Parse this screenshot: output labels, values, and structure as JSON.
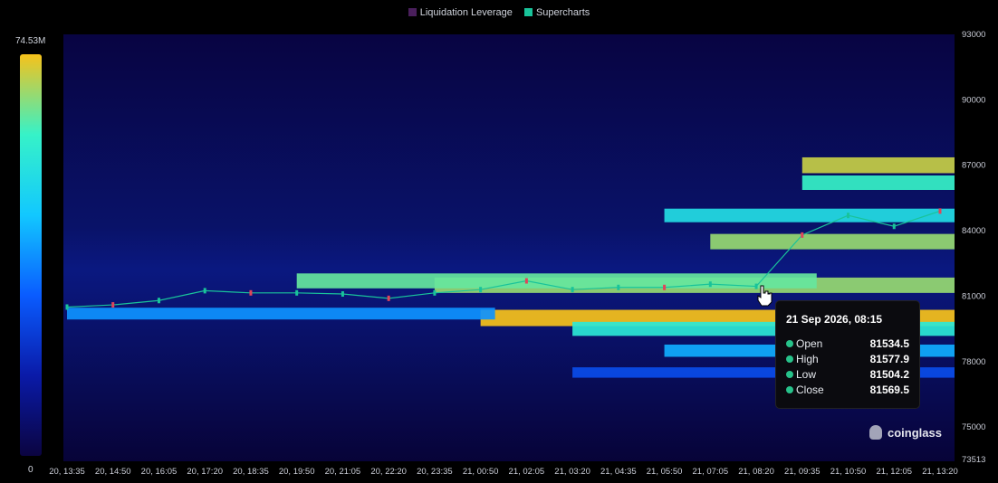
{
  "legend": [
    {
      "label": "Liquidation Leverage",
      "color": "#4a1f5c"
    },
    {
      "label": "Supercharts",
      "color": "#19c39a"
    }
  ],
  "colorbar": {
    "max_label": "74.53M",
    "min_label": "0",
    "stops": [
      "#0b0440",
      "#0a1aa8",
      "#0a5cff",
      "#12c8ff",
      "#36f2c8",
      "#f7c21a"
    ]
  },
  "tooltip": {
    "title": "21 Sep 2026, 08:15",
    "rows": [
      {
        "label": "Open",
        "value": "81534.5"
      },
      {
        "label": "High",
        "value": "81577.9"
      },
      {
        "label": "Low",
        "value": "81504.2"
      },
      {
        "label": "Close",
        "value": "81569.5"
      }
    ]
  },
  "watermark": "coinglass",
  "chart_data": {
    "type": "heatmap",
    "overlay": "candlestick",
    "x_tick_labels": [
      "20, 13:35",
      "20, 14:50",
      "20, 16:05",
      "20, 17:20",
      "20, 18:35",
      "20, 19:50",
      "20, 21:05",
      "20, 22:20",
      "20, 23:35",
      "21, 00:50",
      "21, 02:05",
      "21, 03:20",
      "21, 04:35",
      "21, 05:50",
      "21, 07:05",
      "21, 08:20",
      "21, 09:35",
      "21, 10:50",
      "21, 12:05",
      "21, 13:20"
    ],
    "y_ticks": [
      93000,
      90000,
      87000,
      84000,
      81000,
      78000,
      75000,
      73513
    ],
    "ylim": [
      73513,
      93000
    ],
    "colorbar_range": [
      0,
      74530000
    ],
    "price_series": [
      {
        "t": "20, 13:35",
        "price": 80500
      },
      {
        "t": "20, 14:50",
        "price": 80600
      },
      {
        "t": "20, 16:05",
        "price": 80800
      },
      {
        "t": "20, 17:20",
        "price": 81250
      },
      {
        "t": "20, 18:35",
        "price": 81150
      },
      {
        "t": "20, 19:50",
        "price": 81150
      },
      {
        "t": "20, 21:05",
        "price": 81100
      },
      {
        "t": "20, 22:20",
        "price": 80900
      },
      {
        "t": "20, 23:35",
        "price": 81150
      },
      {
        "t": "21, 00:50",
        "price": 81300
      },
      {
        "t": "21, 02:05",
        "price": 81700
      },
      {
        "t": "21, 03:20",
        "price": 81300
      },
      {
        "t": "21, 04:35",
        "price": 81400
      },
      {
        "t": "21, 05:50",
        "price": 81400
      },
      {
        "t": "21, 07:05",
        "price": 81550
      },
      {
        "t": "21, 08:20",
        "price": 81450
      },
      {
        "t": "21, 09:35",
        "price": 83800
      },
      {
        "t": "21, 10:50",
        "price": 84700
      },
      {
        "t": "21, 12:05",
        "price": 84200
      },
      {
        "t": "21, 13:20",
        "price": 84900
      }
    ],
    "liquidation_bands": [
      {
        "price": 81500,
        "intensity": 0.9,
        "from": "20, 23:35",
        "to": "21, 13:20"
      },
      {
        "price": 81700,
        "intensity": 0.85,
        "from": "20, 19:50",
        "to": "21, 09:35"
      },
      {
        "price": 80000,
        "intensity": 1.0,
        "from": "21, 00:50",
        "to": "21, 13:20"
      },
      {
        "price": 79500,
        "intensity": 0.75,
        "from": "21, 03:20",
        "to": "21, 13:20"
      },
      {
        "price": 80200,
        "intensity": 0.5,
        "from": "20, 13:35",
        "to": "21, 00:50"
      },
      {
        "price": 83500,
        "intensity": 0.9,
        "from": "21, 07:05",
        "to": "21, 13:20"
      },
      {
        "price": 84700,
        "intensity": 0.7,
        "from": "21, 05:50",
        "to": "21, 13:20"
      },
      {
        "price": 86200,
        "intensity": 0.8,
        "from": "21, 09:35",
        "to": "21, 13:20"
      },
      {
        "price": 87000,
        "intensity": 0.95,
        "from": "21, 09:35",
        "to": "21, 13:20"
      },
      {
        "price": 78500,
        "intensity": 0.55,
        "from": "21, 05:50",
        "to": "21, 13:20"
      },
      {
        "price": 77500,
        "intensity": 0.35,
        "from": "21, 03:20",
        "to": "21, 13:20"
      }
    ]
  }
}
